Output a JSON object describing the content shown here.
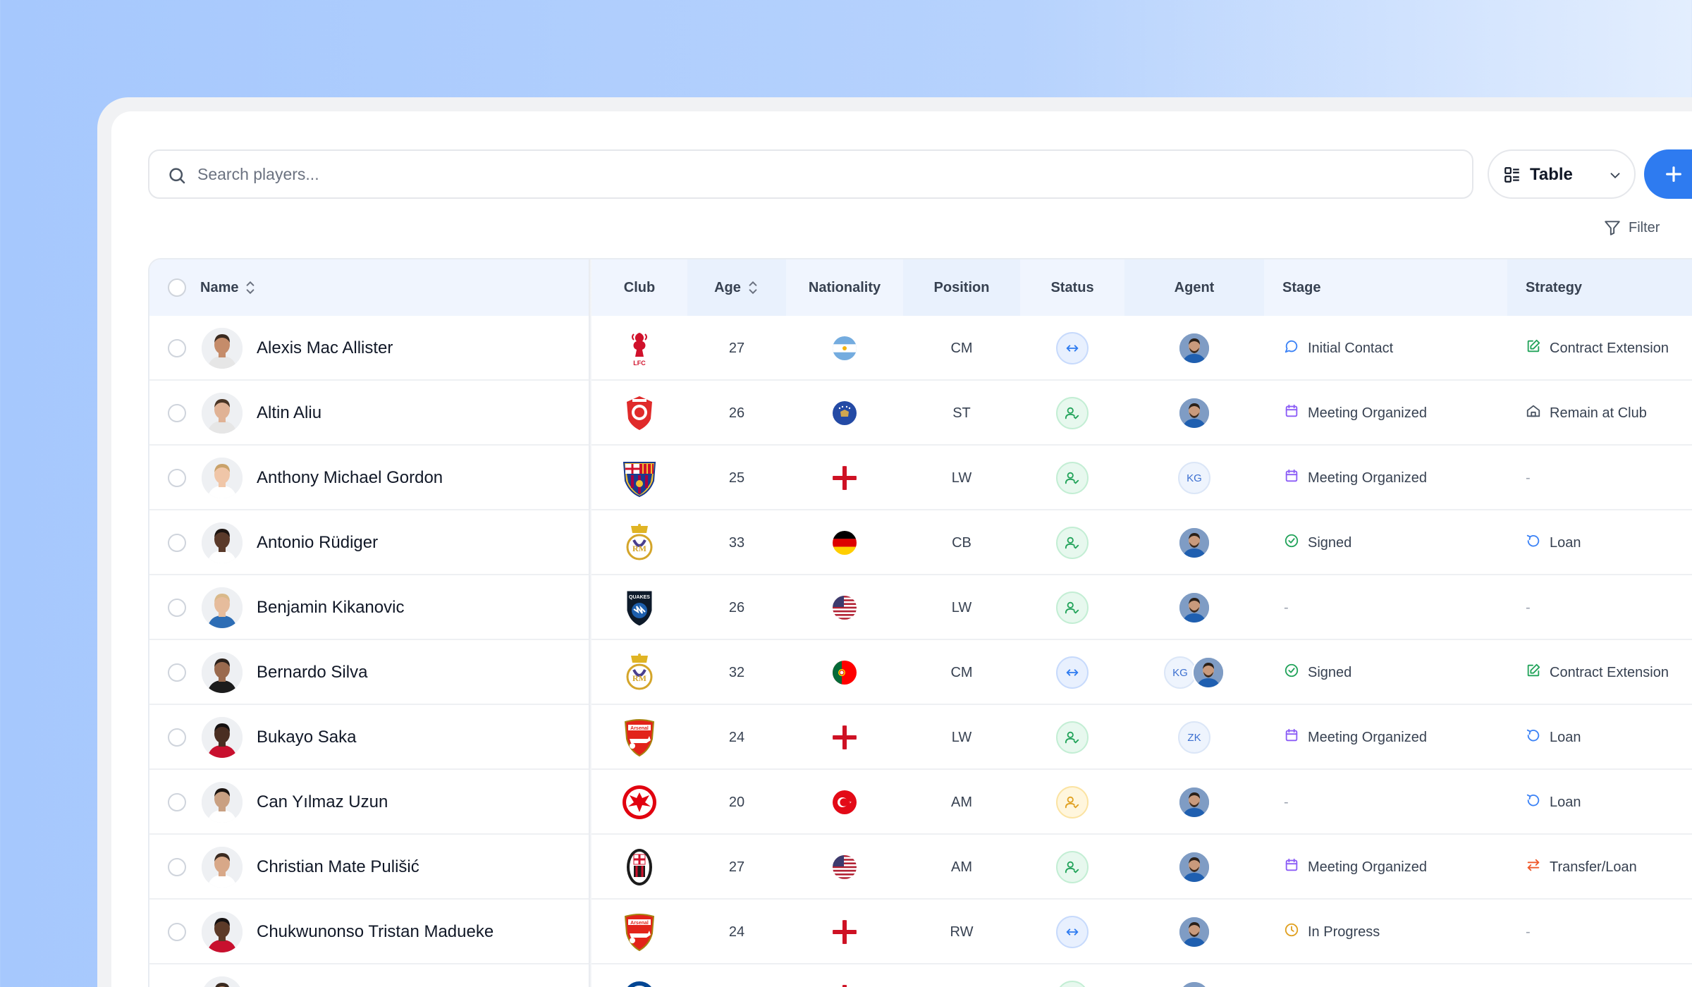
{
  "search": {
    "placeholder": "Search players..."
  },
  "view_selector": {
    "label": "Table"
  },
  "filter": {
    "label": "Filter"
  },
  "columns": {
    "name": "Name",
    "club": "Club",
    "age": "Age",
    "nationality": "Nationality",
    "position": "Position",
    "status": "Status",
    "agent": "Agent",
    "stage": "Stage",
    "strategy": "Strategy"
  },
  "colors": {
    "accent": "#2e7bf0",
    "stage_purple": "#8b5cf6",
    "stage_blue": "#3b82f6",
    "stage_green": "#22a35a",
    "stage_orange": "#e0a020",
    "strategy_green": "#22a35a",
    "strategy_gray": "#4b5563",
    "strategy_orange": "#ef5a2c"
  },
  "rows": [
    {
      "name": "Alexis Mac Allister",
      "club": "liverpool",
      "age": "27",
      "nationality": "argentina",
      "position": "CM",
      "status": "transfer",
      "agents": [
        {
          "type": "photo"
        }
      ],
      "stage": {
        "label": "Initial Contact",
        "icon": "chat-icon"
      },
      "strategy": {
        "label": "Contract Extension",
        "icon": "edit-icon"
      }
    },
    {
      "name": "Altin Aliu",
      "club": "red-crest",
      "age": "26",
      "nationality": "kosovo",
      "position": "ST",
      "status": "sign",
      "agents": [
        {
          "type": "photo"
        }
      ],
      "stage": {
        "label": "Meeting Organized",
        "icon": "calendar-icon"
      },
      "strategy": {
        "label": "Remain at Club",
        "icon": "home-icon"
      }
    },
    {
      "name": "Anthony Michael Gordon",
      "club": "barcelona",
      "age": "25",
      "nationality": "england",
      "position": "LW",
      "status": "sign",
      "agents": [
        {
          "type": "initials",
          "text": "KG"
        }
      ],
      "stage": {
        "label": "Meeting Organized",
        "icon": "calendar-icon"
      },
      "strategy": {
        "label": "-",
        "icon": ""
      }
    },
    {
      "name": "Antonio Rüdiger",
      "club": "real-madrid",
      "age": "33",
      "nationality": "germany",
      "position": "CB",
      "status": "sign",
      "agents": [
        {
          "type": "photo"
        }
      ],
      "stage": {
        "label": "Signed",
        "icon": "check-circle-icon"
      },
      "strategy": {
        "label": "Loan",
        "icon": "rotate-icon"
      }
    },
    {
      "name": "Benjamin Kikanovic",
      "club": "quakes",
      "age": "26",
      "nationality": "usa",
      "position": "LW",
      "status": "sign",
      "agents": [
        {
          "type": "photo"
        }
      ],
      "stage": {
        "label": "-",
        "icon": ""
      },
      "strategy": {
        "label": "-",
        "icon": ""
      }
    },
    {
      "name": "Bernardo Silva",
      "club": "real-madrid",
      "age": "32",
      "nationality": "portugal",
      "position": "CM",
      "status": "transfer",
      "agents": [
        {
          "type": "initials",
          "text": "KG"
        },
        {
          "type": "photo"
        }
      ],
      "stage": {
        "label": "Signed",
        "icon": "check-circle-icon"
      },
      "strategy": {
        "label": "Contract Extension",
        "icon": "edit-icon"
      }
    },
    {
      "name": "Bukayo Saka",
      "club": "arsenal",
      "age": "24",
      "nationality": "england",
      "position": "LW",
      "status": "sign",
      "agents": [
        {
          "type": "initials",
          "text": "ZK"
        }
      ],
      "stage": {
        "label": "Meeting Organized",
        "icon": "calendar-icon"
      },
      "strategy": {
        "label": "Loan",
        "icon": "rotate-icon"
      }
    },
    {
      "name": "Can Yılmaz Uzun",
      "club": "eintracht",
      "age": "20",
      "nationality": "turkey",
      "position": "AM",
      "status": "pending",
      "agents": [
        {
          "type": "photo"
        }
      ],
      "stage": {
        "label": "-",
        "icon": ""
      },
      "strategy": {
        "label": "Loan",
        "icon": "rotate-icon"
      }
    },
    {
      "name": "Christian Mate Pulišić",
      "club": "ac-milan",
      "age": "27",
      "nationality": "usa",
      "position": "AM",
      "status": "sign",
      "agents": [
        {
          "type": "photo"
        }
      ],
      "stage": {
        "label": "Meeting Organized",
        "icon": "calendar-icon"
      },
      "strategy": {
        "label": "Transfer/Loan",
        "icon": "arrows-icon"
      }
    },
    {
      "name": "Chukwunonso Tristan Madueke",
      "club": "arsenal",
      "age": "24",
      "nationality": "england",
      "position": "RW",
      "status": "transfer",
      "agents": [
        {
          "type": "photo"
        }
      ],
      "stage": {
        "label": "In Progress",
        "icon": "clock-icon"
      },
      "strategy": {
        "label": "-",
        "icon": ""
      }
    },
    {
      "name": "",
      "club": "chelsea",
      "age": "",
      "nationality": "england",
      "position": "",
      "status": "sign",
      "agents": [
        {
          "type": "photo"
        }
      ],
      "stage": {
        "label": "",
        "icon": ""
      },
      "strategy": {
        "label": "",
        "icon": ""
      }
    }
  ]
}
